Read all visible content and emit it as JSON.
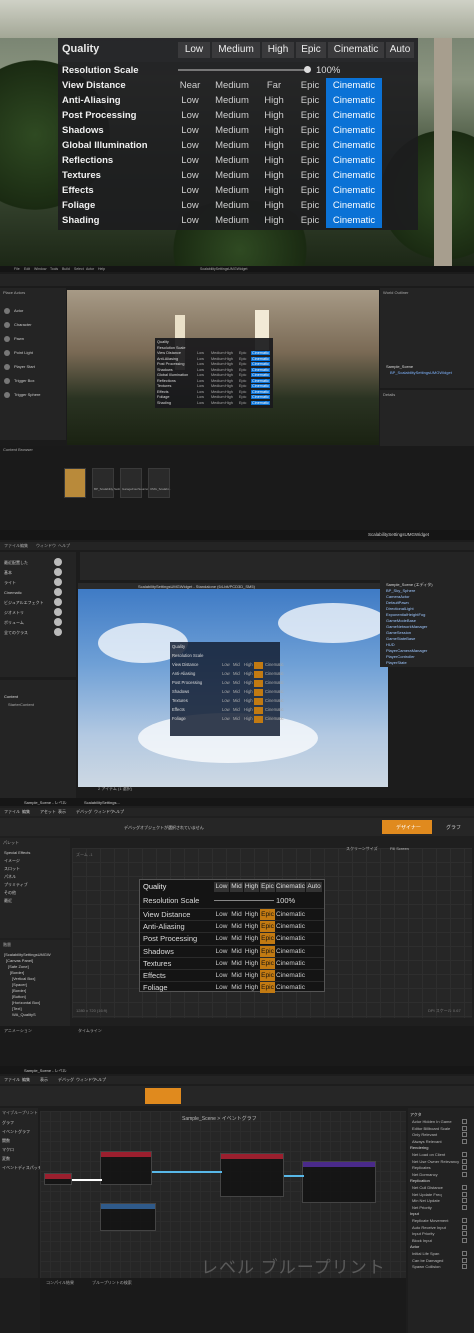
{
  "settings": {
    "title": "Quality",
    "presets": [
      "Low",
      "Medium",
      "High",
      "Epic",
      "Cinematic",
      "Auto"
    ],
    "resolution_label": "Resolution Scale",
    "resolution_value": "100%",
    "rows": [
      {
        "label": "View Distance",
        "options": [
          "Near",
          "Medium",
          "Far",
          "Epic",
          "Cinematic"
        ]
      },
      {
        "label": "Anti-Aliasing",
        "options": [
          "Low",
          "Medium",
          "High",
          "Epic",
          "Cinematic"
        ]
      },
      {
        "label": "Post Processing",
        "options": [
          "Low",
          "Medium",
          "High",
          "Epic",
          "Cinematic"
        ]
      },
      {
        "label": "Shadows",
        "options": [
          "Low",
          "Medium",
          "High",
          "Epic",
          "Cinematic"
        ]
      },
      {
        "label": "Global Illumination",
        "options": [
          "Low",
          "Medium",
          "High",
          "Epic",
          "Cinematic"
        ]
      },
      {
        "label": "Reflections",
        "options": [
          "Low",
          "Medium",
          "High",
          "Epic",
          "Cinematic"
        ]
      },
      {
        "label": "Textures",
        "options": [
          "Low",
          "Medium",
          "High",
          "Epic",
          "Cinematic"
        ]
      },
      {
        "label": "Effects",
        "options": [
          "Low",
          "Medium",
          "High",
          "Epic",
          "Cinematic"
        ]
      },
      {
        "label": "Foliage",
        "options": [
          "Low",
          "Medium",
          "High",
          "Epic",
          "Cinematic"
        ]
      },
      {
        "label": "Shading",
        "options": [
          "Low",
          "Medium",
          "High",
          "Epic",
          "Cinematic"
        ]
      }
    ],
    "selected": "Cinematic",
    "accent": "#0b72d6"
  },
  "editor2": {
    "menu": [
      "File",
      "Edit",
      "Window",
      "Tools",
      "Build",
      "Select",
      "Actor",
      "Help"
    ],
    "project": "ScalabilitySettingsUMGWidget",
    "place_actors": "Place Actors",
    "outliner": "World Outliner",
    "details": "Details",
    "content_browser": "Content Browser",
    "content_items": [
      "",
      "BP_Scalability SettingsUMG Widget",
      "GarageFourSourceEngine",
      "UMG_Scalabi..."
    ],
    "outliner_items": [
      "Sample_Scene",
      "BP_ScalabilitySettingsUMGWidget"
    ],
    "place_items": [
      "Actor",
      "Character",
      "Pawn",
      "Point Light",
      "Player Start",
      "Trigger Box",
      "Trigger Sphere"
    ]
  },
  "editor3": {
    "window_title": "ScalabilitySettingsUMGWidget",
    "viewport_title": "ScalabilitySettingsUMGWidget - Standalone (64-bit/PCD3D_SM5)",
    "menu": [
      "ファイル",
      "編集",
      "ウィンドウ",
      "ヘルプ"
    ],
    "left_menu": [
      "最近配置した",
      "基本",
      "ライト",
      "Cinematic",
      "ビジュアルエフェクト",
      "ジオメトリ",
      "ボリューム",
      "全てのクラス"
    ],
    "outliner_items": [
      "Sample_Scene (エディタ)",
      "BP_Sky_Sphere",
      "CameraActor",
      "DefaultPawn",
      "DirectionalLight",
      "ExponentialHeightFog",
      "GameModeBase",
      "GameNetworkManager",
      "GameSession",
      "GameStateBase",
      "HUD",
      "PlayerCameraManager",
      "PlayerController",
      "PlayerState"
    ],
    "content": "Content",
    "starter": "StarterContent",
    "items_label": "2 アイテム (1 選択)",
    "mini_rows": [
      "Quality",
      "Resolution Scale",
      "View Distance",
      "Anti-Aliasing",
      "Post Processing",
      "Shadows",
      "Textures",
      "Effects",
      "Foliage"
    ]
  },
  "editor4": {
    "tabs": [
      "Sample_Scene - レベル",
      "ScalabilitySettings..."
    ],
    "menu": [
      "ファイル",
      "編集",
      "アセット",
      "表示",
      "デバッグ",
      "ウィンドウ",
      "ヘルプ"
    ],
    "designer_btn": "デザイナー",
    "graph_btn": "グラフ",
    "palette": "パレット",
    "hierarchy": "階層",
    "animations": "アニメーション",
    "timeline": "タイムライン",
    "debug_filter": "デバッグオブジェクトが選択されていません",
    "screen_size": "スクリーンサイズ",
    "fill_screen": "Fill Screen",
    "zoom": "ズーム -1",
    "resolution": "1280 x 720 (16:9)",
    "dpi": "DPI スケール 0.67",
    "palette_items": [
      "Special Effects",
      "イメージ",
      "スロット",
      "パネル",
      "プリミティブ",
      "その他",
      "最近"
    ],
    "hierarchy_items": [
      "[ScalabilitySettingsUMGW",
      "[Canvas Panel]",
      "[Safe Zone]",
      "[Border]",
      "[Vertical Box]",
      "[Spacer]",
      "[Border]",
      "[Button]",
      "[Horizontal Box]",
      "[Text]",
      "WA_QualityS"
    ],
    "panel": {
      "title": "Quality",
      "presets": [
        "Low",
        "Mid",
        "High",
        "Epic",
        "Cinematic",
        "Auto"
      ],
      "resolution_label": "Resolution Scale",
      "resolution_value": "100%",
      "rows": [
        {
          "label": "View Distance",
          "options": [
            "Low",
            "Mid",
            "High",
            "Epic",
            "Cinematic"
          ]
        },
        {
          "label": "Anti-Aliasing",
          "options": [
            "Low",
            "Mid",
            "High",
            "Epic",
            "Cinematic"
          ]
        },
        {
          "label": "Post Processing",
          "options": [
            "Low",
            "Mid",
            "High",
            "Epic",
            "Cinematic"
          ]
        },
        {
          "label": "Shadows",
          "options": [
            "Low",
            "Mid",
            "High",
            "Epic",
            "Cinematic"
          ]
        },
        {
          "label": "Textures",
          "options": [
            "Low",
            "Mid",
            "High",
            "Epic",
            "Cinematic"
          ]
        },
        {
          "label": "Effects",
          "options": [
            "Low",
            "Mid",
            "High",
            "Epic",
            "Cinematic"
          ]
        },
        {
          "label": "Foliage",
          "options": [
            "Low",
            "Mid",
            "High",
            "Epic",
            "Cinematic"
          ]
        }
      ],
      "selected": "Epic",
      "accent": "#c27a12"
    }
  },
  "editor5": {
    "tab": "Sample_Scene - レベル",
    "menu": [
      "ファイル",
      "編集",
      "表示",
      "デバッグ",
      "ウィンドウ",
      "ヘルプ"
    ],
    "breadcrumb": "Sample_Scene > イベントグラフ",
    "watermark": "レベル ブループリント",
    "my_blueprint": "マイブループリント",
    "left_items": [
      "グラフ",
      "イベントグラフ",
      "関数",
      "マクロ",
      "変数",
      "イベントディスパッチャー"
    ],
    "compile_results": "コンパイル結果",
    "find_results": "ブループリントの検索",
    "details_sections": [
      "アクタ",
      "Rendering",
      "Replication",
      "Input",
      "Actor"
    ],
    "detail_rows": [
      "Actor Hidden In Game",
      "Editor Billboard Scale",
      "Only Relevant",
      "Always Relevant",
      "Net Load on Client",
      "Net Use Owner Relevancy",
      "Replicates",
      "Net Dormancy",
      "Net Cull Distance",
      "Net Update Freq",
      "Min Net Update",
      "Net Priority",
      "Replicate Movement",
      "Auto Receive Input",
      "Input Priority",
      "Block Input",
      "Initial Life Span",
      "Can be Damaged",
      "Spawn Collision"
    ]
  }
}
